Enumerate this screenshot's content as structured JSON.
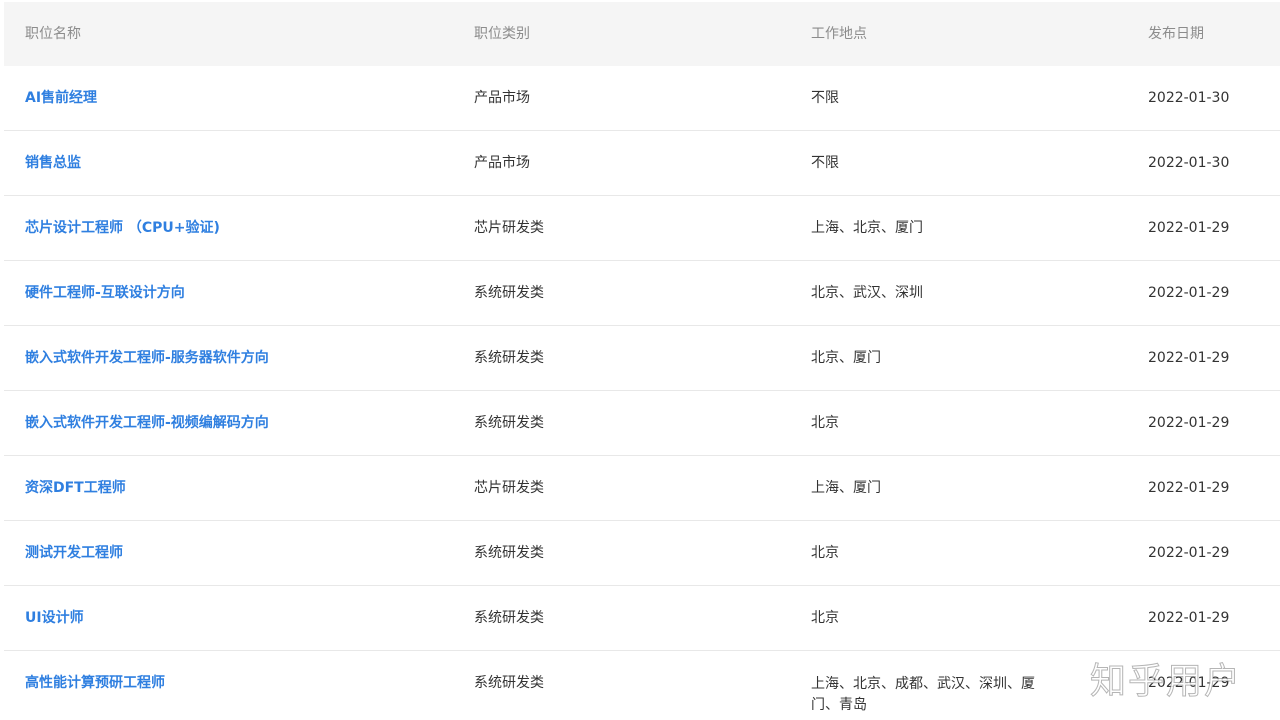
{
  "headers": {
    "name": "职位名称",
    "category": "职位类别",
    "location": "工作地点",
    "date": "发布日期"
  },
  "jobs": [
    {
      "name": "AI售前经理",
      "category": "产品市场",
      "location": "不限",
      "date": "2022-01-30"
    },
    {
      "name": "销售总监",
      "category": "产品市场",
      "location": "不限",
      "date": "2022-01-30"
    },
    {
      "name": "芯片设计工程师 （CPU+验证)",
      "category": "芯片研发类",
      "location": "上海、北京、厦门",
      "date": "2022-01-29"
    },
    {
      "name": "硬件工程师-互联设计方向",
      "category": "系统研发类",
      "location": "北京、武汉、深圳",
      "date": "2022-01-29"
    },
    {
      "name": "嵌入式软件开发工程师-服务器软件方向",
      "category": "系统研发类",
      "location": "北京、厦门",
      "date": "2022-01-29"
    },
    {
      "name": "嵌入式软件开发工程师-视频编解码方向",
      "category": "系统研发类",
      "location": "北京",
      "date": "2022-01-29"
    },
    {
      "name": "资深DFT工程师",
      "category": "芯片研发类",
      "location": "上海、厦门",
      "date": "2022-01-29"
    },
    {
      "name": "测试开发工程师",
      "category": "系统研发类",
      "location": "北京",
      "date": "2022-01-29"
    },
    {
      "name": "UI设计师",
      "category": "系统研发类",
      "location": "北京",
      "date": "2022-01-29"
    },
    {
      "name": "高性能计算预研工程师",
      "category": "系统研发类",
      "location": "上海、北京、成都、武汉、深圳、厦门、青岛",
      "date": "2022-01-29"
    }
  ],
  "watermark": "知乎用户"
}
